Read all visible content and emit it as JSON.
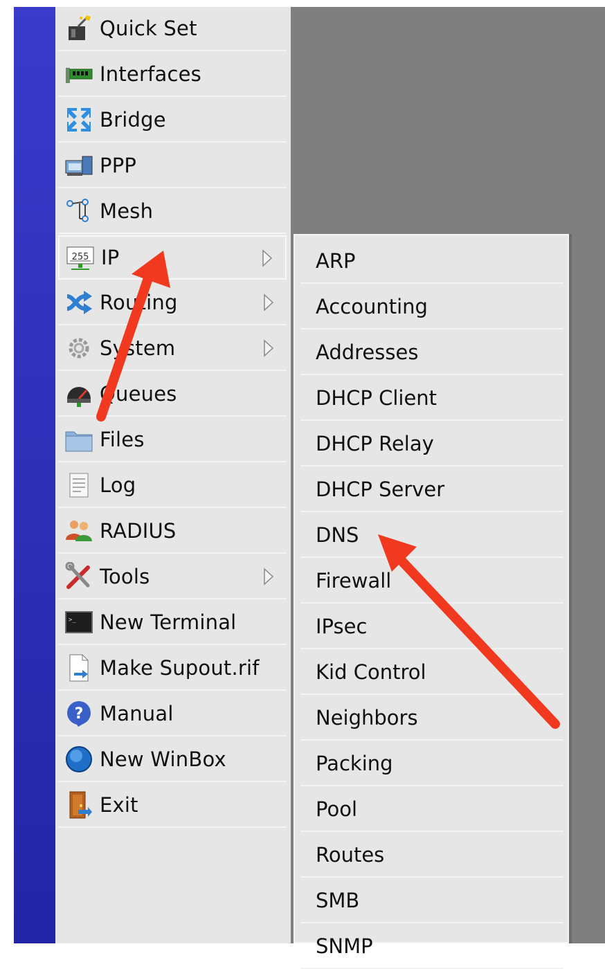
{
  "main_menu": {
    "items": [
      {
        "label": "Quick Set",
        "icon": "quick-set-icon",
        "has_submenu": false
      },
      {
        "label": "Interfaces",
        "icon": "interfaces-icon",
        "has_submenu": false
      },
      {
        "label": "Bridge",
        "icon": "bridge-icon",
        "has_submenu": false
      },
      {
        "label": "PPP",
        "icon": "ppp-icon",
        "has_submenu": false
      },
      {
        "label": "Mesh",
        "icon": "mesh-icon",
        "has_submenu": false
      },
      {
        "label": "IP",
        "icon": "ip-icon",
        "has_submenu": true,
        "icon_text": "255"
      },
      {
        "label": "Routing",
        "icon": "routing-icon",
        "has_submenu": true
      },
      {
        "label": "System",
        "icon": "system-gear-icon",
        "has_submenu": true
      },
      {
        "label": "Queues",
        "icon": "queues-gauge-icon",
        "has_submenu": false
      },
      {
        "label": "Files",
        "icon": "folder-icon",
        "has_submenu": false
      },
      {
        "label": "Log",
        "icon": "log-document-icon",
        "has_submenu": false
      },
      {
        "label": "RADIUS",
        "icon": "radius-users-icon",
        "has_submenu": false
      },
      {
        "label": "Tools",
        "icon": "tools-icon",
        "has_submenu": true
      },
      {
        "label": "New Terminal",
        "icon": "terminal-icon",
        "has_submenu": false
      },
      {
        "label": "Make Supout.rif",
        "icon": "supout-file-icon",
        "has_submenu": false
      },
      {
        "label": "Manual",
        "icon": "help-icon",
        "has_submenu": false
      },
      {
        "label": "New WinBox",
        "icon": "winbox-globe-icon",
        "has_submenu": false
      },
      {
        "label": "Exit",
        "icon": "exit-door-icon",
        "has_submenu": false
      }
    ],
    "selected": "IP"
  },
  "ip_submenu": {
    "items": [
      "ARP",
      "Accounting",
      "Addresses",
      "DHCP Client",
      "DHCP Relay",
      "DHCP Server",
      "DNS",
      "Firewall",
      "IPsec",
      "Kid Control",
      "Neighbors",
      "Packing",
      "Pool",
      "Routes",
      "SMB",
      "SNMP"
    ]
  },
  "colors": {
    "side_bar": "#2f2fb8",
    "menu_bg": "#e6e6e6",
    "workspace_bg": "#7f7f7f",
    "annotation_arrow": "#f0391f"
  }
}
